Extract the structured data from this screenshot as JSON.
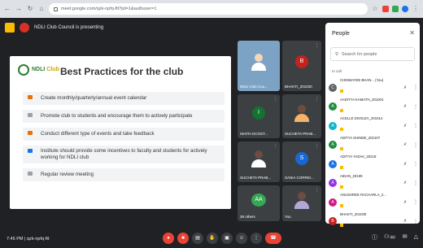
{
  "browser": {
    "url": "meet.google.com/qzk-npfq-ftt?pli=1&authuser=1"
  },
  "meet": {
    "title": "NDLI Club Council is presenting"
  },
  "slide": {
    "brand_main": "NDLI",
    "brand_accent": "Club",
    "title": "Best Practices for the club",
    "items": [
      {
        "text": "Create monthly/quarterly/annual event calendar",
        "color": "#e8710a"
      },
      {
        "text": "Promote club to students and encourage them to actively participate",
        "color": "#9aa0a6"
      },
      {
        "text": "Conduct different type of events and take feedback",
        "color": "#e8710a"
      },
      {
        "text": "Institute should provide some incentives to faculty and students for actively working for NDLI club",
        "color": "#1a73e8"
      },
      {
        "text": "Regular review meeting",
        "color": "#9aa0a6"
      }
    ]
  },
  "tiles": [
    {
      "name": "NDLI Club Cou...",
      "type": "video"
    },
    {
      "name": "BHAKTI_201030",
      "initial": "B",
      "color": "#c5221f"
    },
    {
      "name": "ISHITA DCOST...",
      "initial": "I",
      "color": "#137333"
    },
    {
      "name": "SUCHETA PRAB...",
      "type": "photo"
    },
    {
      "name": "SUCHETA PRAB...",
      "type": "photo"
    },
    {
      "name": "SANIA CORREI...",
      "initial": "S",
      "color": "#1967d2"
    },
    {
      "name": "39 others",
      "type": "others"
    },
    {
      "name": "You",
      "type": "photo"
    }
  ],
  "people_panel": {
    "title": "People",
    "search_placeholder": "Search for people",
    "section_label": "In call",
    "people": [
      {
        "name": "CHINMAYEE BHAN... (You)",
        "initial": "C",
        "color": "#5f6368"
      },
      {
        "name": "AADITYA KAMATH_201004",
        "initial": "A",
        "color": "#1e8e3e"
      },
      {
        "name": "ACELLE DSOUZA_201014",
        "initial": "A",
        "color": "#12b5cb"
      },
      {
        "name": "ADITYA SHINDE_202107",
        "initial": "A",
        "color": "#1e8e3e"
      },
      {
        "name": "ADITYA YADAV_20218",
        "initial": "A",
        "color": "#1a73e8"
      },
      {
        "name": "AIDAN_20199",
        "initial": "A",
        "color": "#9334e6"
      },
      {
        "name": "ANUSHREE RACHARLA_2...",
        "initial": "A",
        "color": "#d01884"
      },
      {
        "name": "BHAKTI_201030",
        "initial": "B",
        "color": "#c5221f"
      }
    ]
  },
  "bottom": {
    "time_code": "7:45 PM | qzk-npfq-ftt",
    "participants_count": "46"
  }
}
